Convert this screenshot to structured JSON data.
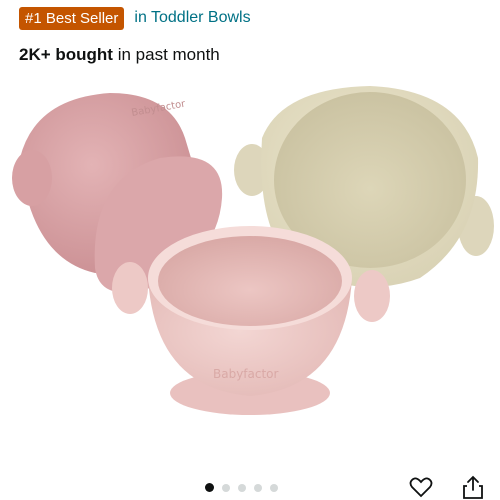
{
  "badge": {
    "label": "#1 Best Seller",
    "color": "#c45500"
  },
  "category": {
    "link": "in Toddler Bowls",
    "color": "#007185"
  },
  "purchase_stat": {
    "count": "2K+ bought",
    "suffix": "in past month"
  },
  "product_image": {
    "bowls": [
      {
        "color": "pink",
        "position": "back-left"
      },
      {
        "color": "cream",
        "position": "back-right"
      },
      {
        "color": "light-pink",
        "position": "front"
      }
    ],
    "embossed_text": "Babyfactor"
  },
  "carousel": {
    "total": 5,
    "active": 0
  },
  "actions": {
    "favorite_icon": "heart-icon",
    "share_icon": "share-icon"
  }
}
